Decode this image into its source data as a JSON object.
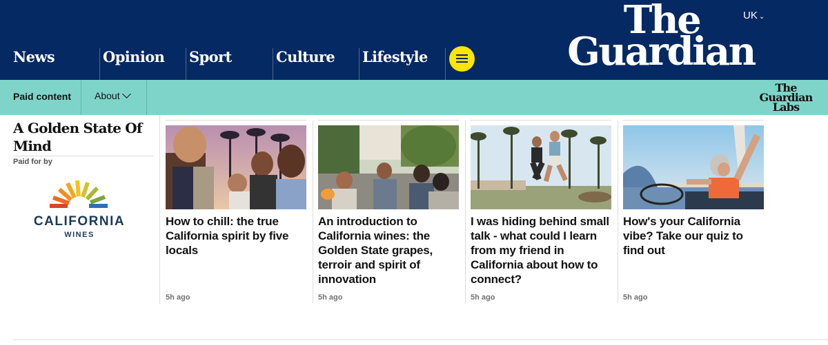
{
  "header": {
    "nav": [
      {
        "label": "News"
      },
      {
        "label": "Opinion"
      },
      {
        "label": "Sport"
      },
      {
        "label": "Culture"
      },
      {
        "label": "Lifestyle"
      }
    ],
    "menu_icon": "menu-icon",
    "edition": "UK",
    "logo_line1": "The",
    "logo_line2": "Guardian",
    "bg_color": "#052962",
    "accent_color": "#ffe500"
  },
  "subbar": {
    "paid_label": "Paid content",
    "about_label": "About",
    "labs_line1": "The",
    "labs_line2": "Guardian",
    "labs_line3": "Labs",
    "bg_color": "#7fd4c9"
  },
  "series": {
    "title": "A Golden State Of Mind",
    "paid_for_by": "Paid for by",
    "sponsor_name": "CALIFORNIA",
    "sponsor_sub": "WINES"
  },
  "cards": [
    {
      "headline": "How to chill: the true California spirit by five locals",
      "time": "5h ago"
    },
    {
      "headline": "An introduction to California wines: the Golden State grapes, terroir and spirit of innovation",
      "time": "5h ago"
    },
    {
      "headline": "I was hiding behind small talk - what could I learn from my friend in California about how to connect?",
      "time": "5h ago"
    },
    {
      "headline": "How's your California vibe? Take our quiz to find out",
      "time": "5h ago"
    }
  ]
}
